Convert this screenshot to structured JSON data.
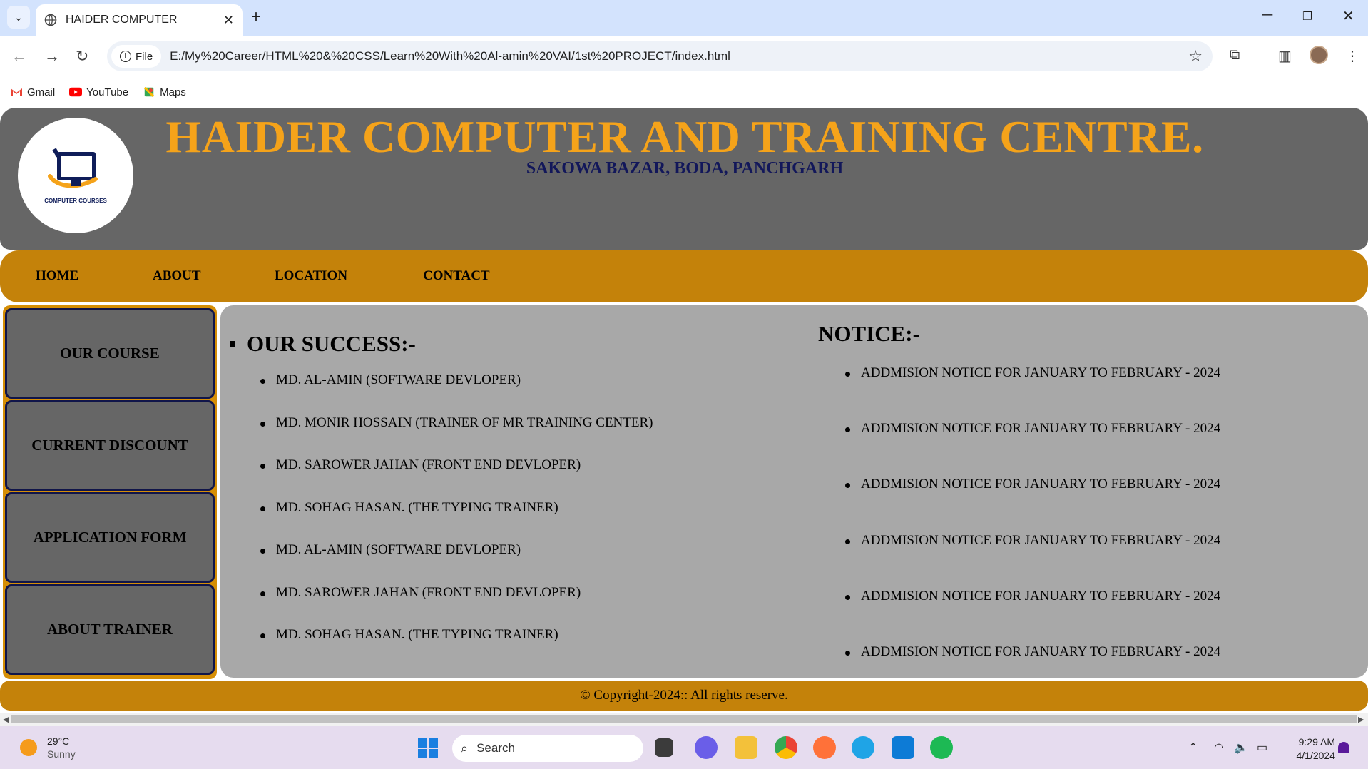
{
  "browser": {
    "tab_title": "HAIDER COMPUTER",
    "url_scheme": "File",
    "url": "E:/My%20Career/HTML%20&%20CSS/Learn%20With%20Al-amin%20VAI/1st%20PROJECT/index.html",
    "bookmarks": [
      {
        "label": "Gmail",
        "icon": "gmail-icon"
      },
      {
        "label": "YouTube",
        "icon": "youtube-icon"
      },
      {
        "label": "Maps",
        "icon": "maps-icon"
      }
    ]
  },
  "page": {
    "logo_text": "COMPUTER COURSES",
    "title": "HAIDER COMPUTER AND TRAINING CENTRE.",
    "subtitle": "SAKOWA BAZAR, BODA, PANCHGARH",
    "nav": [
      "HOME",
      "ABOUT",
      "LOCATION",
      "CONTACT"
    ],
    "sidebar": [
      "OUR COURSE",
      "CURRENT DISCOUNT",
      "APPLICATION FORM",
      "ABOUT TRAINER"
    ],
    "success_heading": "OUR SUCCESS:-",
    "success_list": [
      "MD. AL-AMIN (SOFTWARE DEVLOPER)",
      "MD. MONIR HOSSAIN (TRAINER OF MR TRAINING CENTER)",
      "MD. SAROWER JAHAN (FRONT END DEVLOPER)",
      "MD. SOHAG HASAN. (THE TYPING TRAINER)",
      "MD. AL-AMIN (SOFTWARE DEVLOPER)",
      "MD. SAROWER JAHAN (FRONT END DEVLOPER)",
      "MD. SOHAG HASAN. (THE TYPING TRAINER)"
    ],
    "notice_heading": "NOTICE:-",
    "notice_list": [
      "ADDMISION NOTICE FOR JANUARY TO FEBRUARY - 2024",
      "ADDMISION NOTICE FOR JANUARY TO FEBRUARY - 2024",
      "ADDMISION NOTICE FOR JANUARY TO FEBRUARY - 2024",
      "ADDMISION NOTICE FOR JANUARY TO FEBRUARY - 2024",
      "ADDMISION NOTICE FOR JANUARY TO FEBRUARY - 2024",
      "ADDMISION NOTICE FOR JANUARY TO FEBRUARY - 2024"
    ],
    "footer": "© Copyright-2024:: All rights reserve.",
    "colors": {
      "header_bg": "#666666",
      "title": "#f5a31a",
      "nav_bg": "#c4820a",
      "content_bg": "#a8a8a8"
    }
  },
  "taskbar": {
    "temperature": "29°C",
    "condition": "Sunny",
    "search_placeholder": "Search",
    "time": "9:29 AM",
    "date": "4/1/2024"
  }
}
